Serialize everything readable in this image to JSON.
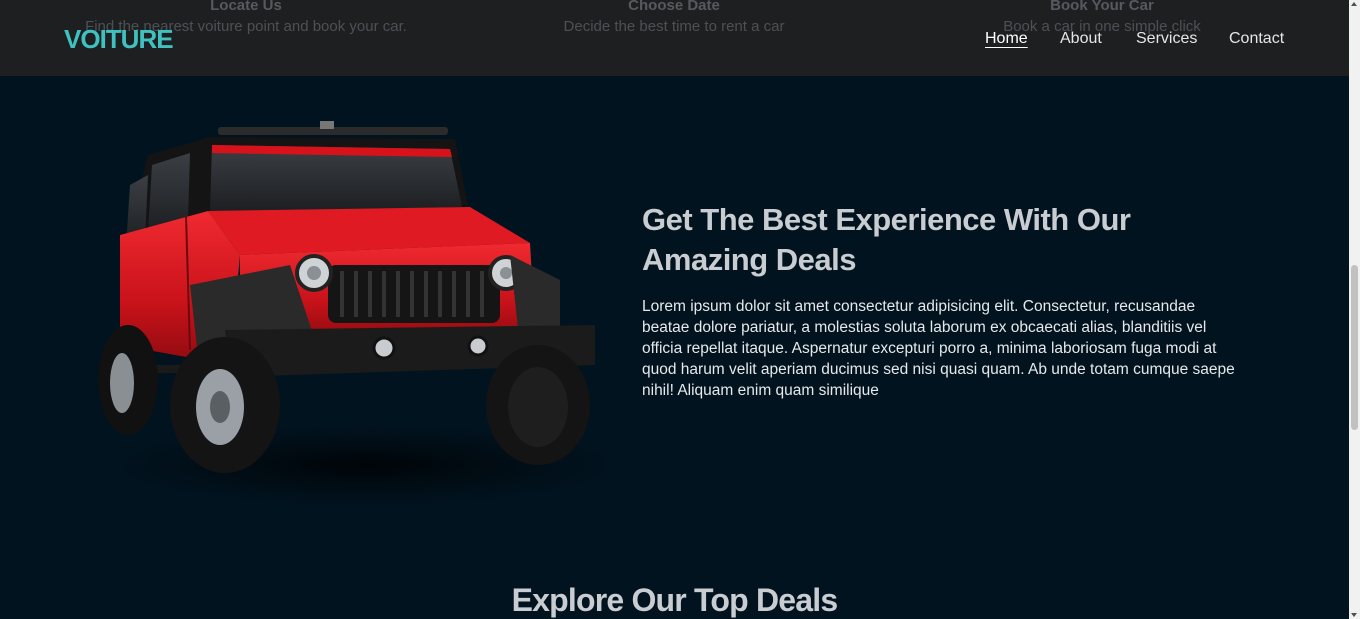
{
  "steps": [
    {
      "title": "Locate Us",
      "desc": "Find the nearest voiture point and book your car."
    },
    {
      "title": "Choose Date",
      "desc": "Decide the best time to rent a car"
    },
    {
      "title": "Book Your Car",
      "desc": "Book a car in one simple click"
    }
  ],
  "navbar": {
    "logo": "VOITURE",
    "links": [
      "Home",
      "About",
      "Services",
      "Contact"
    ],
    "active": "Home"
  },
  "hero": {
    "title": "Get The Best Experience With Our Amazing Deals",
    "text": "Lorem ipsum dolor sit amet consectetur adipisicing elit. Consectetur, recusandae beatae dolore pariatur, a molestias soluta laborum ex obcaecati alias, blanditiis vel officia repellat itaque. Aspernatur excepturi porro a, minima laboriosam fuga modi at quod harum velit aperiam ducimus sed nisi quasi quam. Ab unde totam cumque saepe nihil! Aliquam enim quam similique",
    "image": "red-jeep-image"
  },
  "deals": {
    "title": "Explore Our Top Deals"
  },
  "colors": {
    "accent": "#3fc1c0",
    "background": "#01131f",
    "navbar": "#1e1f20",
    "car_red": "#d8121b"
  }
}
